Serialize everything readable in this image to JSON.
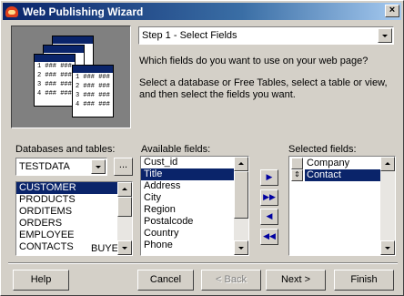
{
  "window": {
    "title": "Web Publishing Wizard",
    "close_label": "×"
  },
  "illustration": {
    "rows": [
      "1 ### ###",
      "2 ### ###",
      "3 ### ###",
      "4 ### ###"
    ]
  },
  "step": {
    "selected": "Step 1 - Select Fields"
  },
  "question": "Which fields do you want to use on your web page?",
  "instructions": "Select a database or Free Tables, select a table or view, and then select the fields you want.",
  "databases": {
    "label": "Databases and tables:",
    "selected_db": "TESTDATA",
    "browse_label": "...",
    "tables": [
      "CUSTOMER",
      "PRODUCTS",
      "ORDITEMS",
      "ORDERS",
      "EMPLOYEE",
      "CONTACTS"
    ],
    "extra_text": "BUYER",
    "selected_index": 0
  },
  "available": {
    "label": "Available fields:",
    "fields": [
      "Cust_id",
      "Title",
      "Address",
      "City",
      "Region",
      "Postalcode",
      "Country",
      "Phone"
    ],
    "selected_index": 1
  },
  "move_buttons": {
    "add": "▶",
    "add_all": "▶▶",
    "remove": "◀",
    "remove_all": "◀◀"
  },
  "selected": {
    "label": "Selected fields:",
    "fields": [
      "Company",
      "Contact"
    ],
    "highlighted_index": 1
  },
  "buttons": {
    "help": "Help",
    "cancel": "Cancel",
    "back": "< Back",
    "next": "Next >",
    "finish": "Finish"
  }
}
